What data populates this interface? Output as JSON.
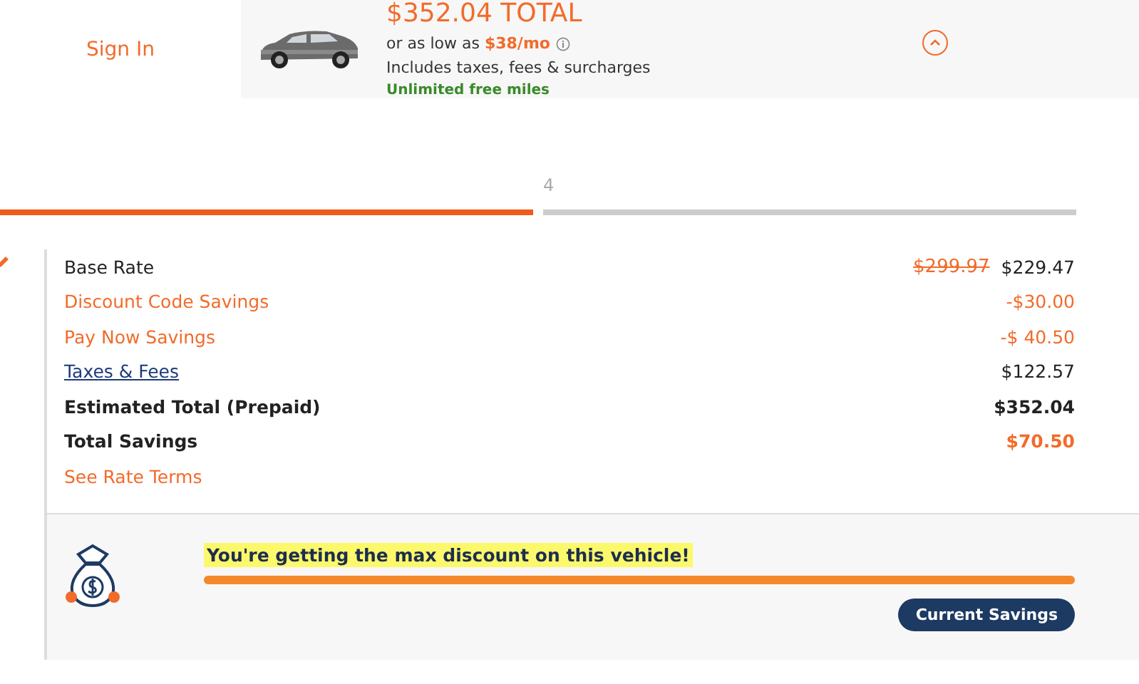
{
  "header": {
    "sign_in": "Sign In",
    "summary": {
      "total": "$352.04 TOTAL",
      "monthly_prefix": "or as low as",
      "monthly": "$38/mo",
      "includes": "Includes taxes, fees & surcharges",
      "miles": "Unlimited free miles",
      "expanded": true
    }
  },
  "steps": [
    {
      "selected": true
    },
    {
      "label": "4",
      "selected": false
    }
  ],
  "rates": [
    {
      "kind": "plain",
      "label": "Base Rate",
      "old": "$299.97",
      "value": "$229.47"
    },
    {
      "kind": "savings",
      "label": "Discount Code Savings",
      "value": "-$30.00"
    },
    {
      "kind": "savings",
      "label": "Pay Now Savings",
      "value": "-$ 40.50"
    },
    {
      "kind": "link",
      "label": "Taxes & Fees",
      "value": "$122.57"
    },
    {
      "kind": "total",
      "label": "Estimated Total (Prepaid)",
      "value": "$352.04"
    },
    {
      "kind": "total-savings",
      "label": "Total Savings",
      "value": "$70.50"
    },
    {
      "kind": "terms",
      "label": "See Rate Terms"
    }
  ],
  "discount": {
    "message": "You're getting the max discount on this vehicle!",
    "level": 1,
    "pill": "Current Savings"
  }
}
